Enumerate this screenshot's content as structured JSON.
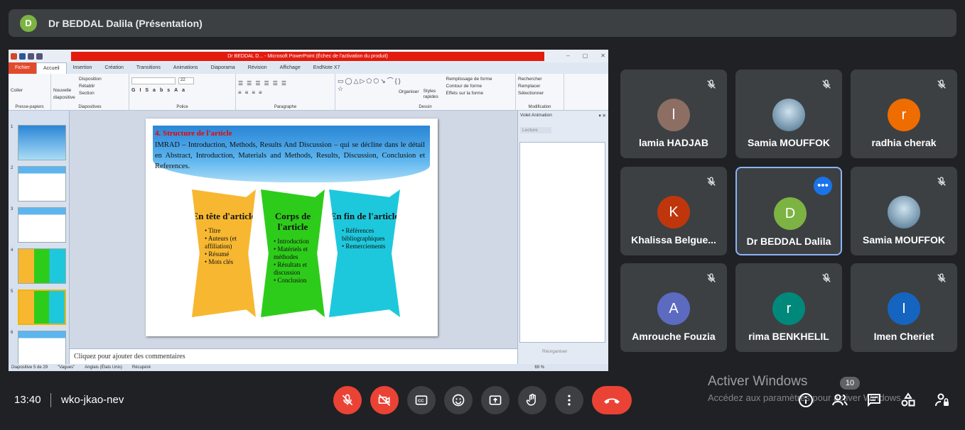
{
  "header": {
    "presenter_initial": "D",
    "title": "Dr BEDDAL Dalila (Présentation)"
  },
  "ppt": {
    "window_title": "Dr BEDDAL D... - Microsoft PowerPoint (Échec de l'activation du produit)",
    "tabs": [
      "Fichier",
      "Accueil",
      "Insertion",
      "Création",
      "Transitions",
      "Animations",
      "Diaporama",
      "Révision",
      "Affichage",
      "EndNote X7"
    ],
    "groups": {
      "clipboard": {
        "name": "Presse-papiers",
        "items": [
          "Coller"
        ]
      },
      "slides": {
        "name": "Diapositives",
        "items": [
          "Nouvelle diapositive",
          "Disposition",
          "Rétablir",
          "Section"
        ]
      },
      "font": {
        "name": "Police",
        "size": "22"
      },
      "paragraph": {
        "name": "Paragraphe"
      },
      "drawing": {
        "name": "Dessin",
        "items": [
          "Organiser",
          "Styles rapides",
          "Remplissage de forme",
          "Contour de forme",
          "Effets sur la forme"
        ]
      },
      "editing": {
        "name": "Modification",
        "items": [
          "Rechercher",
          "Remplacer",
          "Sélectionner"
        ]
      }
    },
    "thumb_numbers": [
      "1",
      "2",
      "3",
      "4",
      "5",
      "6"
    ],
    "slide": {
      "title": "4. Structure de l'article",
      "body": "IMRAD – Introduction, Methods, Results And Discussion – qui se décline dans le détail en Abstract, Introduction, Materials and Methods, Results, Discussion, Conclusion et References.",
      "panels": [
        {
          "title": "En tête d'article",
          "color": "#f7b731",
          "items": [
            "Titre",
            "Auteurs (et affiliation)",
            "Résumé",
            "Mots clés"
          ]
        },
        {
          "title": "Corps de l'article",
          "color": "#2ecc1a",
          "items": [
            "Introduction",
            "Matériels et méthodes",
            "Résultats et discussion",
            "Conclusion"
          ]
        },
        {
          "title": "En fin de l'article",
          "color": "#1ec8dc",
          "items": [
            "Références bibliographiques",
            "Remerciements"
          ]
        }
      ]
    },
    "comments_placeholder": "Cliquez pour ajouter des commentaires",
    "anim_pane": {
      "title": "Volet Animation",
      "play": "Lecture",
      "reorder": "Réorganiser"
    },
    "status": {
      "slide_info": "Diapositive 5 de 29",
      "theme": "\"Vagues\"",
      "language": "Anglais (États Unis)",
      "recovered": "Récupéré",
      "zoom": "69 %"
    }
  },
  "participants": [
    {
      "name": "lamia HADJAB",
      "initial": "l",
      "color": "#8d6e63",
      "muted": true
    },
    {
      "name": "Samia MOUFFOK",
      "initial": "",
      "color": "photo",
      "muted": true
    },
    {
      "name": "radhia cherak",
      "initial": "r",
      "color": "#ef6c00",
      "muted": true
    },
    {
      "name": "Khalissa Belgue...",
      "initial": "K",
      "color": "#bf360c",
      "muted": true
    },
    {
      "name": "Dr BEDDAL Dalila",
      "initial": "D",
      "color": "#7cb342",
      "muted": false,
      "selected": true
    },
    {
      "name": "Samia MOUFFOK",
      "initial": "",
      "color": "photo",
      "muted": true
    },
    {
      "name": "Amrouche Fouzia",
      "initial": "A",
      "color": "#5c6bc0",
      "muted": true
    },
    {
      "name": "rima BENKHELIL",
      "initial": "r",
      "color": "#00897b",
      "muted": true
    },
    {
      "name": "Imen Cheriet",
      "initial": "I",
      "color": "#1565c0",
      "muted": true
    }
  ],
  "meeting": {
    "time": "13:40",
    "code": "wko-jkao-nev",
    "participant_count": "10"
  },
  "watermark": {
    "line1": "Activer Windows",
    "line2": "Accédez aux paramètres pour activer Windows."
  }
}
